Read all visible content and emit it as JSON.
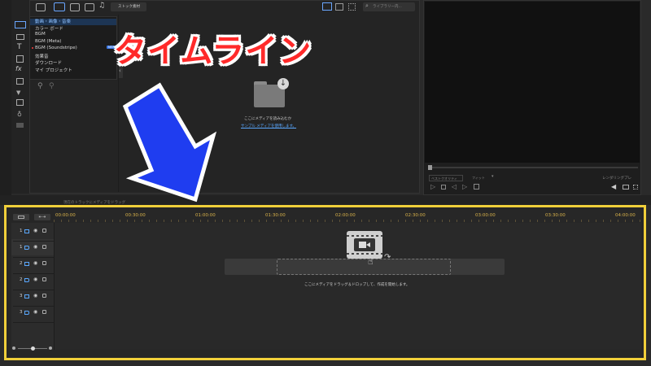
{
  "library": {
    "top_tabs": [
      "stock_label"
    ],
    "stock_label": "ストック素材",
    "search_placeholder": "ライブラリー内...",
    "menu_items": [
      {
        "label": "動画・画像・音楽"
      },
      {
        "label": "カラー ボード"
      },
      {
        "label": "BGM"
      },
      {
        "label": "BGM (Meta)"
      },
      {
        "label": "BGM (Soundstripe)",
        "badge": "NEW"
      },
      {
        "label": "効果音"
      },
      {
        "label": "ダウンロード"
      },
      {
        "label": "マイ プロジェクト"
      }
    ],
    "import_text": "ここにメディアを読み込むか",
    "sample_link": "サンプル メディアを使用します。"
  },
  "overlay": {
    "title": "タイムライン",
    "accent": "#ff2a2a",
    "arrow_color": "#1f3df0"
  },
  "preview": {
    "quality_select": "ベストクオリティ",
    "fit_select": "フィット",
    "render_label": "レンダリングプレ"
  },
  "timeline": {
    "header_hint": "現在のトラックにメディアをドラッグ",
    "ruler": [
      "00:00:00",
      "00:30:00",
      "01:00:00",
      "01:30:00",
      "02:00:00",
      "02:30:00",
      "03:00:00",
      "03:30:00",
      "04:00:00"
    ],
    "tracks": [
      {
        "num": "1",
        "type": "video"
      },
      {
        "num": "1",
        "type": "audio"
      },
      {
        "num": "2",
        "type": "video"
      },
      {
        "num": "2",
        "type": "audio"
      },
      {
        "num": "3",
        "type": "video"
      },
      {
        "num": "3",
        "type": "audio"
      }
    ],
    "drop_hint": "ここにメディアをドラッグ＆ドロップして、作成を開始します。",
    "highlight_color": "#f0cf3a"
  }
}
